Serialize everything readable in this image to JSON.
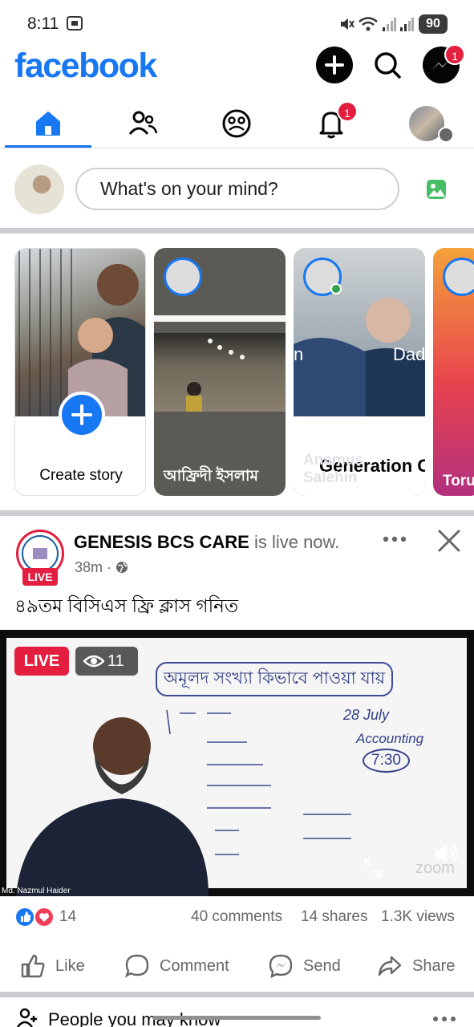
{
  "status": {
    "time": "8:11",
    "battery": "90"
  },
  "header": {
    "logo": "facebook",
    "messenger_badge": "1",
    "notifications_badge": "1"
  },
  "composer": {
    "placeholder": "What's on your mind?"
  },
  "stories": [
    {
      "label": "Create story",
      "kind": "create"
    },
    {
      "label": "আফ্রিদী ইসলাম",
      "kind": "story"
    },
    {
      "label": "Anamus Salehin",
      "kind": "story",
      "overlay": "Generation C",
      "overlay_top": "Dad"
    },
    {
      "label": "Toru",
      "kind": "story"
    }
  ],
  "post": {
    "page_name": "GENESIS BCS CARE",
    "status_suffix": "is live now.",
    "time_ago": "38m",
    "live_label": "LIVE",
    "text": "৪৯তম বিসিএস ফ্রি ক্লাস গনিত",
    "video": {
      "live_tag": "LIVE",
      "viewer_count": "11",
      "presenter": "Md. Nazmul Haider",
      "board_heading": "অমূলদ সংখ্যা কিভাবে পাওয়া যায়",
      "board_date": "28 July",
      "board_subject": "Accounting",
      "board_time": "7:30",
      "brand": "zoom"
    },
    "reaction_count": "14",
    "comments": "40 comments",
    "shares": "14 shares",
    "views": "1.3K views",
    "actions": {
      "like": "Like",
      "comment": "Comment",
      "send": "Send",
      "share": "Share"
    }
  },
  "next_section": {
    "title": "People you may know"
  },
  "colors": {
    "brand": "#1877f2",
    "badge": "#e41e3f",
    "live": "#e41e3f"
  }
}
